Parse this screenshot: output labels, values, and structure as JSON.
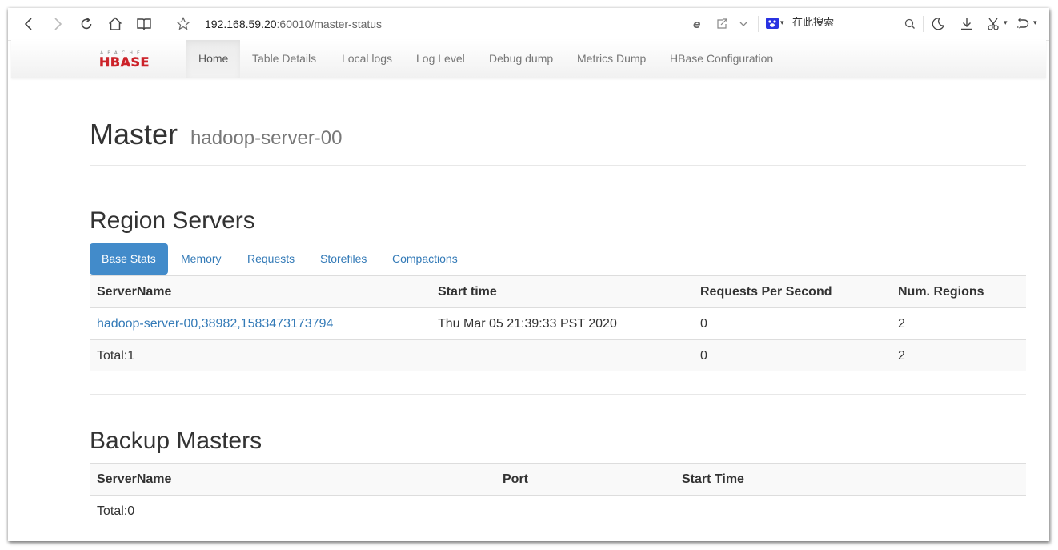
{
  "browser": {
    "url_host": "192.168.59.20",
    "url_rest": ":60010/master-status",
    "search_placeholder": "在此搜索"
  },
  "navbar": {
    "logo_top": "APACHE",
    "logo_main": "HBASE",
    "items": [
      "Home",
      "Table Details",
      "Local logs",
      "Log Level",
      "Debug dump",
      "Metrics Dump",
      "HBase Configuration"
    ]
  },
  "page": {
    "title": "Master",
    "subtitle": "hadoop-server-00"
  },
  "region_servers": {
    "heading": "Region Servers",
    "tabs": [
      "Base Stats",
      "Memory",
      "Requests",
      "Storefiles",
      "Compactions"
    ],
    "columns": [
      "ServerName",
      "Start time",
      "Requests Per Second",
      "Num. Regions"
    ],
    "rows": [
      [
        "hadoop-server-00,38982,1583473173794",
        "Thu Mar 05 21:39:33 PST 2020",
        "0",
        "2"
      ]
    ],
    "total": [
      "Total:1",
      "",
      "0",
      "2"
    ]
  },
  "backup_masters": {
    "heading": "Backup Masters",
    "columns": [
      "ServerName",
      "Port",
      "Start Time"
    ],
    "total": "Total:0"
  },
  "colors": {
    "link": "#337ab7",
    "active_tab": "#428bca",
    "logo_red": "#cc2229"
  }
}
